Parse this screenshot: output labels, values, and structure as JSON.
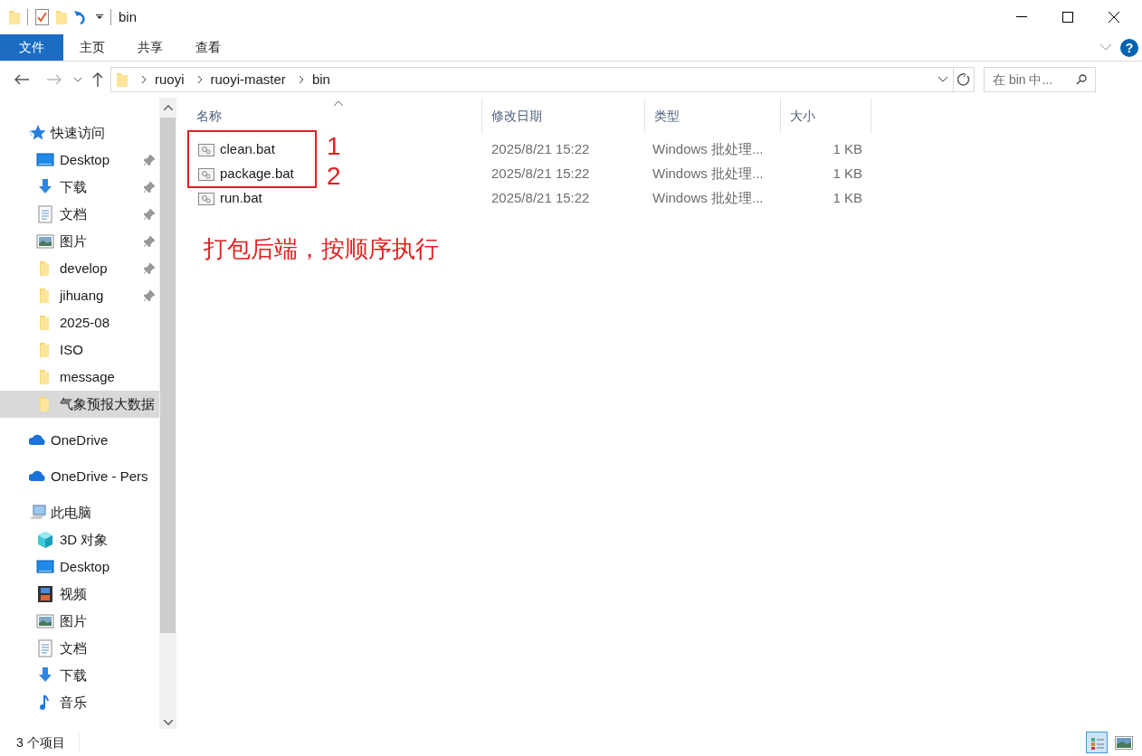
{
  "window": {
    "title": "bin"
  },
  "help_button": {
    "label": "?"
  },
  "ribbon_tabs": [
    {
      "label": "文件",
      "selected": true
    },
    {
      "label": "主页",
      "selected": false
    },
    {
      "label": "共享",
      "selected": false
    },
    {
      "label": "查看",
      "selected": false
    }
  ],
  "address": {
    "path": [
      "ruoyi",
      "ruoyi-master",
      "bin"
    ]
  },
  "search": {
    "placeholder": "在 bin 中..."
  },
  "sidebar": {
    "items": [
      {
        "label": "快速访问",
        "kind": "star",
        "children": [
          {
            "label": "Desktop",
            "kind": "desktop",
            "pinned": true,
            "selected": false
          },
          {
            "label": "下载",
            "kind": "download",
            "pinned": true,
            "selected": false
          },
          {
            "label": "文档",
            "kind": "doc",
            "pinned": true,
            "selected": false
          },
          {
            "label": "图片",
            "kind": "picture",
            "pinned": true,
            "selected": false
          },
          {
            "label": "develop",
            "kind": "folder",
            "pinned": true,
            "selected": false
          },
          {
            "label": "jihuang",
            "kind": "folder",
            "pinned": true,
            "selected": false
          },
          {
            "label": "2025-08",
            "kind": "folder",
            "pinned": false,
            "selected": false
          },
          {
            "label": "ISO",
            "kind": "folder",
            "pinned": false,
            "selected": false
          },
          {
            "label": "message",
            "kind": "folder",
            "pinned": false,
            "selected": false
          },
          {
            "label": "气象预报大数据",
            "kind": "folder",
            "pinned": false,
            "selected": true
          }
        ]
      },
      {
        "label": "OneDrive",
        "kind": "cloud"
      },
      {
        "label": "OneDrive - Pers",
        "kind": "cloud"
      },
      {
        "label": "此电脑",
        "kind": "pc",
        "children": [
          {
            "label": "3D 对象",
            "kind": "cube",
            "pinned": false,
            "selected": false
          },
          {
            "label": "Desktop",
            "kind": "desktop",
            "pinned": false,
            "selected": false
          },
          {
            "label": "视频",
            "kind": "video",
            "pinned": false,
            "selected": false
          },
          {
            "label": "图片",
            "kind": "picture",
            "pinned": false,
            "selected": false
          },
          {
            "label": "文档",
            "kind": "doc",
            "pinned": false,
            "selected": false
          },
          {
            "label": "下载",
            "kind": "download",
            "pinned": false,
            "selected": false
          },
          {
            "label": "音乐",
            "kind": "music",
            "pinned": false,
            "selected": false
          }
        ]
      }
    ]
  },
  "table": {
    "columns": [
      "名称",
      "修改日期",
      "类型",
      "大小"
    ],
    "rows": [
      {
        "name": "clean.bat",
        "modified": "2025/8/21 15:22",
        "type": "Windows 批处理...",
        "size": "1 KB"
      },
      {
        "name": "package.bat",
        "modified": "2025/8/21 15:22",
        "type": "Windows 批处理...",
        "size": "1 KB"
      },
      {
        "name": "run.bat",
        "modified": "2025/8/21 15:22",
        "type": "Windows 批处理...",
        "size": "1 KB"
      }
    ]
  },
  "annotations": {
    "step_labels": [
      "1",
      "2"
    ],
    "note": "打包后端，按顺序执行"
  },
  "status_bar": {
    "item_count": "3 个项目",
    "views": [
      {
        "kind": "details",
        "selected": true
      },
      {
        "kind": "large_icons",
        "selected": false
      }
    ]
  }
}
